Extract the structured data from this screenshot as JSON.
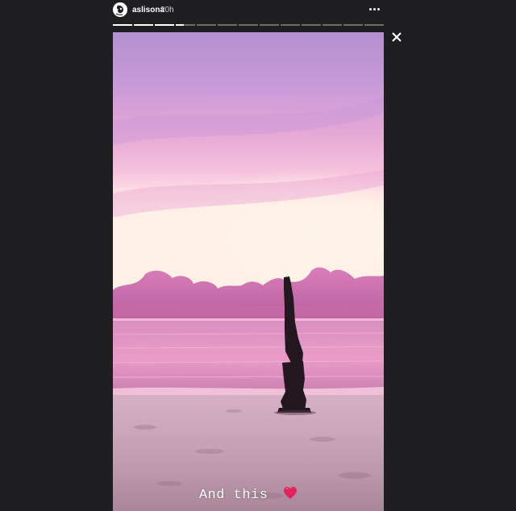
{
  "story": {
    "username": "aslisona",
    "timestamp": "20h",
    "caption": "And this",
    "caption_emoji": "red-heart-icon",
    "segments_total": 13,
    "segments_viewed": 3,
    "current_segment_progress": 0.4
  },
  "icons": {
    "more": "more-horizontal-icon",
    "close": "close-icon",
    "avatar": "avatar"
  },
  "colors": {
    "background": "#1f1f21",
    "heart": "#e0245e",
    "progress_fill": "#ffffff",
    "progress_track": "rgba(255,255,255,0.35)"
  }
}
